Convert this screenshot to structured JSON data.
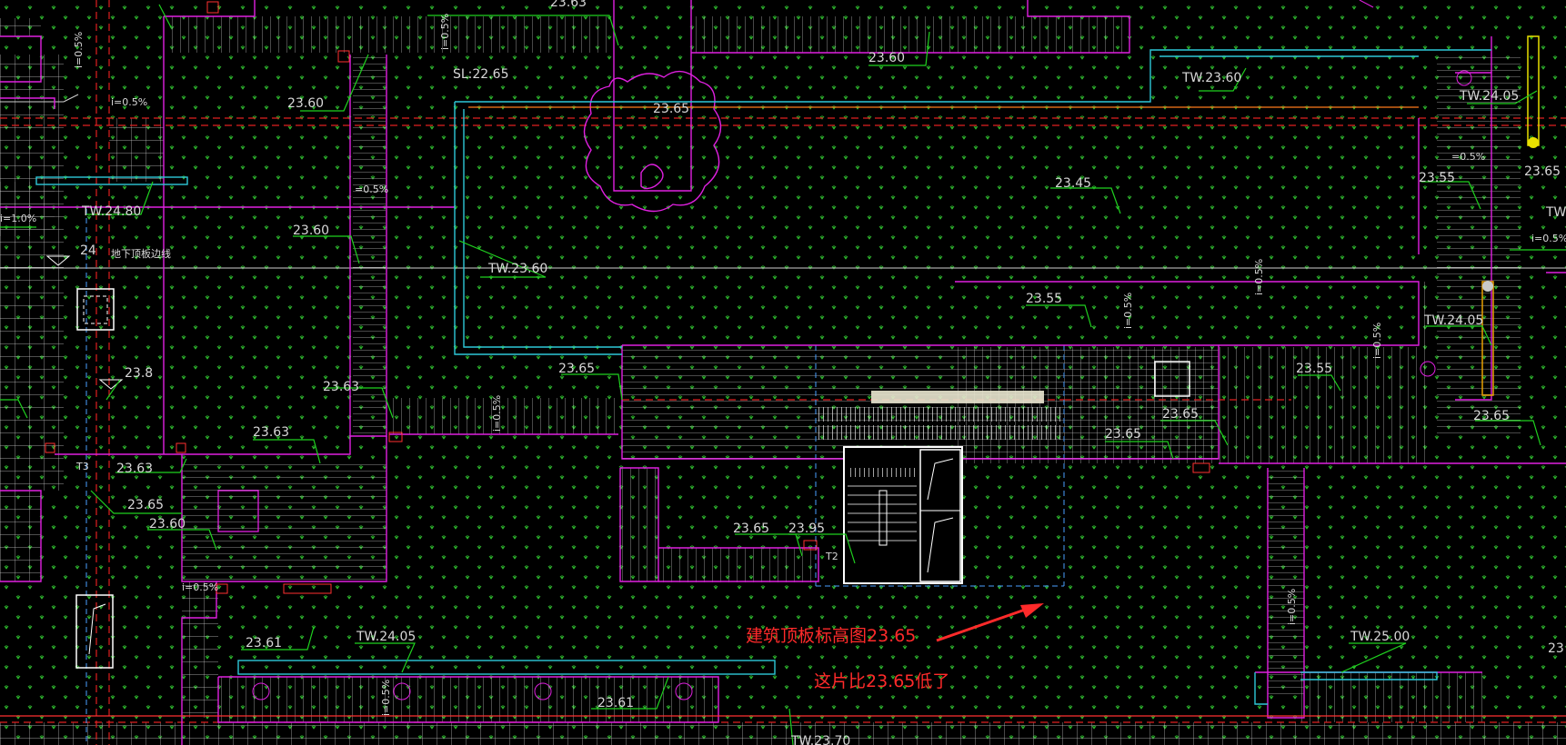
{
  "drawing": {
    "background": "#000000",
    "colors": {
      "boundary": "#e020e0",
      "wall": "#2ec8d8",
      "leader": "#1fd11f",
      "grass": "#2fbf2f",
      "axis": "#e02020",
      "annotation": "#ff2a2a",
      "text": "#d8d8d8"
    },
    "labels": [
      {
        "id": "l1",
        "text": "23.63"
      },
      {
        "id": "l2",
        "text": "23.60"
      },
      {
        "id": "l3",
        "text": "SL:22.65"
      },
      {
        "id": "l4",
        "text": "23.60"
      },
      {
        "id": "l5",
        "text": "i=0.5%"
      },
      {
        "id": "l6",
        "text": "23.65"
      },
      {
        "id": "l7",
        "text": "TW.23.60"
      },
      {
        "id": "l8",
        "text": "TW.24.05"
      },
      {
        "id": "l9",
        "text": "=0.5%"
      },
      {
        "id": "l10",
        "text": "=0.5%"
      },
      {
        "id": "l11",
        "text": "i=1.0%"
      },
      {
        "id": "l12",
        "text": "TW.24.80"
      },
      {
        "id": "l13",
        "text": "23.45"
      },
      {
        "id": "l14",
        "text": "23.55"
      },
      {
        "id": "l15",
        "text": "23.65"
      },
      {
        "id": "l16",
        "text": "TW"
      },
      {
        "id": "l17",
        "text": "i=0.5%"
      },
      {
        "id": "l18",
        "text": "23.60"
      },
      {
        "id": "l19",
        "text": "24"
      },
      {
        "id": "l20",
        "text": "地下顶板边线"
      },
      {
        "id": "l21",
        "text": "TW.23.60"
      },
      {
        "id": "l22",
        "text": "23.55"
      },
      {
        "id": "l23",
        "text": "TW.24.05"
      },
      {
        "id": "l24",
        "text": "23.8"
      },
      {
        "id": "l25",
        "text": "23.63"
      },
      {
        "id": "l26",
        "text": "23.65"
      },
      {
        "id": "l27",
        "text": "23.55"
      },
      {
        "id": "l28",
        "text": "23.65"
      },
      {
        "id": "l29",
        "text": "23.65"
      },
      {
        "id": "l30",
        "text": "23.65"
      },
      {
        "id": "l31",
        "text": "23.63"
      },
      {
        "id": "l32",
        "text": "T3"
      },
      {
        "id": "l33",
        "text": "23.63"
      },
      {
        "id": "l34",
        "text": "23.65"
      },
      {
        "id": "l35",
        "text": "23.60"
      },
      {
        "id": "l36",
        "text": "23.65"
      },
      {
        "id": "l37",
        "text": "23.95"
      },
      {
        "id": "l38",
        "text": "T2"
      },
      {
        "id": "l39",
        "text": "i=0.5%"
      },
      {
        "id": "l40",
        "text": "23.61"
      },
      {
        "id": "l41",
        "text": "TW.24.05"
      },
      {
        "id": "l42",
        "text": "TW.25.00"
      },
      {
        "id": "l43",
        "text": "23.61"
      },
      {
        "id": "l44",
        "text": "TW.23.70"
      },
      {
        "id": "l45",
        "text": "23"
      }
    ],
    "slope_marks": [
      {
        "id": "s1",
        "text": "i=0.5%"
      },
      {
        "id": "s2",
        "text": "i=0.5%"
      },
      {
        "id": "s3",
        "text": "i=0.5%"
      },
      {
        "id": "s4",
        "text": "i=0.5%"
      },
      {
        "id": "s5",
        "text": "i=0.5%"
      },
      {
        "id": "s6",
        "text": "i=0.5%"
      },
      {
        "id": "s7",
        "text": "i=0.5%"
      },
      {
        "id": "s8",
        "text": "i=0.5%"
      }
    ],
    "annotation": {
      "line1": "建筑顶板标高图23.65",
      "line2": "这片比23.65低了"
    }
  }
}
